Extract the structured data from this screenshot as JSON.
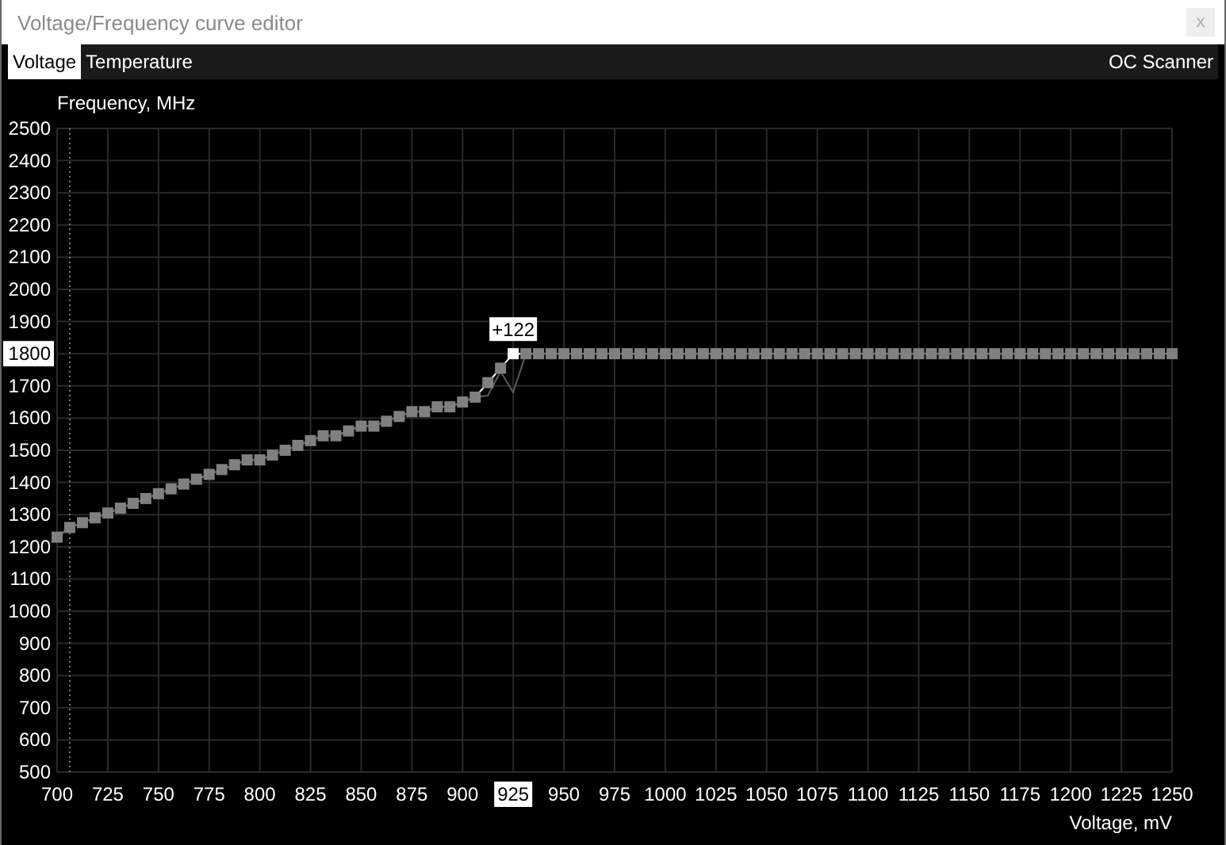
{
  "window": {
    "title": "Voltage/Frequency curve editor",
    "close": "x"
  },
  "tabs": [
    {
      "label": "Voltage",
      "selected": true
    },
    {
      "label": "Temperature",
      "selected": false
    }
  ],
  "scanner": {
    "label": "OC Scanner"
  },
  "chart": {
    "chart_data": {
      "type": "line",
      "grid": true,
      "ref_lines": [
        {
          "axis": "x",
          "value": 706.25
        }
      ],
      "xlabel": "Voltage, mV",
      "ylabel": "Frequency, MHz",
      "x": [
        700,
        706.25,
        712.5,
        718.75,
        725,
        731.25,
        737.5,
        743.75,
        750,
        756.25,
        762.5,
        768.75,
        775,
        781.25,
        787.5,
        793.75,
        800,
        806.25,
        812.5,
        818.75,
        825,
        831.25,
        837.5,
        843.75,
        850,
        856.25,
        862.5,
        868.75,
        875,
        881.25,
        887.5,
        893.75,
        900,
        906.25,
        912.5,
        918.75,
        925,
        931.25,
        937.5,
        943.75,
        950,
        956.25,
        962.5,
        968.75,
        975,
        981.25,
        987.5,
        993.75,
        1000,
        1006.25,
        1012.5,
        1018.75,
        1025,
        1031.25,
        1037.5,
        1043.75,
        1050,
        1056.25,
        1062.5,
        1068.75,
        1075,
        1081.25,
        1087.5,
        1093.75,
        1100,
        1106.25,
        1112.5,
        1118.75,
        1125,
        1131.25,
        1137.5,
        1143.75,
        1150,
        1156.25,
        1162.5,
        1168.75,
        1175,
        1181.25,
        1187.5,
        1193.75,
        1200,
        1206.25,
        1212.5,
        1218.75,
        1225,
        1231.25,
        1237.5,
        1243.75,
        1250
      ],
      "series": [
        {
          "color": "#808080",
          "marker": "square",
          "values": [
            1230,
            1260,
            1275,
            1290,
            1305,
            1320,
            1335,
            1350,
            1365,
            1380,
            1395,
            1410,
            1425,
            1440,
            1455,
            1470,
            1470,
            1485,
            1500,
            1515,
            1530,
            1545,
            1545,
            1560,
            1575,
            1575,
            1590,
            1605,
            1620,
            1620,
            1635,
            1635,
            1650,
            1665,
            1710,
            1755,
            1800,
            1800,
            1800,
            1800,
            1800,
            1800,
            1800,
            1800,
            1800,
            1800,
            1800,
            1800,
            1800,
            1800,
            1800,
            1800,
            1800,
            1800,
            1800,
            1800,
            1800,
            1800,
            1800,
            1800,
            1800,
            1800,
            1800,
            1800,
            1800,
            1800,
            1800,
            1800,
            1800,
            1800,
            1800,
            1800,
            1800,
            1800,
            1800,
            1800,
            1800,
            1800,
            1800,
            1800,
            1800,
            1800,
            1800,
            1800,
            1800,
            1800,
            1800,
            1800,
            1800
          ]
        },
        {
          "color": "#5a5a5a",
          "values": [
            1230,
            1260,
            1275,
            1290,
            1305,
            1320,
            1335,
            1350,
            1365,
            1380,
            1395,
            1410,
            1425,
            1440,
            1455,
            1470,
            1470,
            1485,
            1500,
            1515,
            1530,
            1545,
            1545,
            1560,
            1575,
            1575,
            1590,
            1605,
            1620,
            1620,
            1635,
            1635,
            1650,
            1665,
            1670,
            1745,
            1680,
            1800,
            1800,
            1800,
            1800,
            1800,
            1800,
            1800,
            1800,
            1800,
            1800,
            1800,
            1800,
            1800,
            1800,
            1800,
            1800,
            1800,
            1800,
            1800,
            1800,
            1800,
            1800,
            1800,
            1800,
            1800,
            1800,
            1800,
            1800,
            1800,
            1800,
            1800,
            1800,
            1800,
            1800,
            1800,
            1800,
            1800,
            1800,
            1800,
            1800,
            1800,
            1800,
            1800,
            1800,
            1800,
            1800,
            1800,
            1800,
            1800,
            1800,
            1800,
            1800
          ]
        }
      ],
      "xlim": [
        700,
        1250
      ],
      "ylim": [
        500,
        2500
      ],
      "xticks": [
        700,
        725,
        750,
        775,
        800,
        825,
        850,
        875,
        900,
        925,
        950,
        975,
        1000,
        1025,
        1050,
        1075,
        1100,
        1125,
        1150,
        1175,
        1200,
        1225,
        1250
      ],
      "yticks": [
        500,
        600,
        700,
        800,
        900,
        1000,
        1100,
        1200,
        1300,
        1400,
        1500,
        1600,
        1700,
        1800,
        1900,
        2000,
        2100,
        2200,
        2300,
        2400,
        2500
      ],
      "annotations": [
        {
          "x": 925,
          "y": 1800,
          "text": "+122"
        }
      ]
    }
  }
}
